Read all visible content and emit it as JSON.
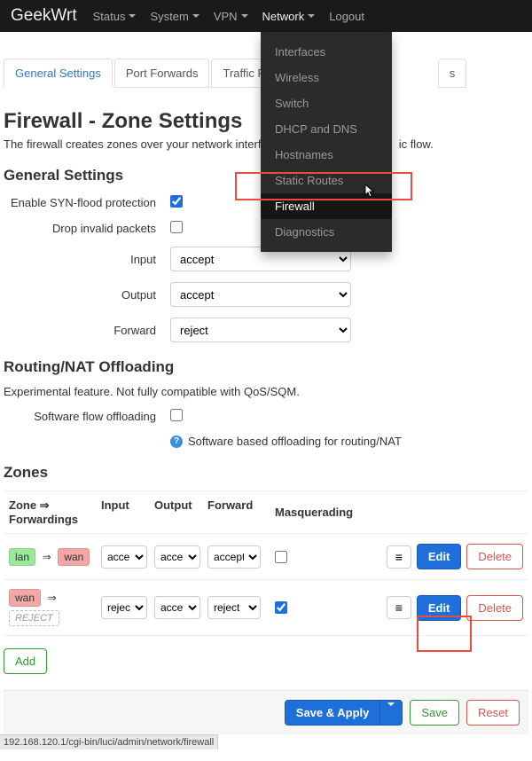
{
  "navbar": {
    "brand": "GeekWrt",
    "items": [
      "Status",
      "System",
      "VPN",
      "Network",
      "Logout"
    ]
  },
  "dropdown": {
    "items": [
      "Interfaces",
      "Wireless",
      "Switch",
      "DHCP and DNS",
      "Hostnames",
      "Static Routes",
      "Firewall",
      "Diagnostics"
    ],
    "hovered_index": 6
  },
  "tabs": [
    "General Settings",
    "Port Forwards",
    "Traffic Rules",
    "",
    "s"
  ],
  "page": {
    "title": "Firewall - Zone Settings",
    "desc_a": "The firewall creates zones over your network interfa",
    "desc_b": "ic flow."
  },
  "general": {
    "heading": "General Settings",
    "syn_label": "Enable SYN-flood protection",
    "syn_checked": true,
    "drop_label": "Drop invalid packets",
    "drop_checked": false,
    "input_label": "Input",
    "input_value": "accept",
    "output_label": "Output",
    "output_value": "accept",
    "forward_label": "Forward",
    "forward_value": "reject"
  },
  "offload": {
    "heading": "Routing/NAT Offloading",
    "desc": "Experimental feature. Not fully compatible with QoS/SQM.",
    "sw_label": "Software flow offloading",
    "sw_checked": false,
    "help": "Software based offloading for routing/NAT"
  },
  "zones": {
    "heading": "Zones",
    "head": {
      "zone": "Zone ⇒ Forwardings",
      "input": "Input",
      "output": "Output",
      "forward": "Forward",
      "masq": "Masquerading"
    },
    "rows": [
      {
        "from": "lan",
        "to": "wan",
        "input": "accept",
        "output": "accept",
        "forward": "accept",
        "masq": false
      },
      {
        "from": "wan",
        "to": "REJECT",
        "input": "reject",
        "output": "accept",
        "forward": "reject",
        "masq": true
      }
    ],
    "edit": "Edit",
    "delete": "Delete",
    "add": "Add"
  },
  "footer": {
    "save_apply": "Save & Apply",
    "save": "Save",
    "reset": "Reset"
  },
  "status_bar": "192.168.120.1/cgi-bin/luci/admin/network/firewall"
}
